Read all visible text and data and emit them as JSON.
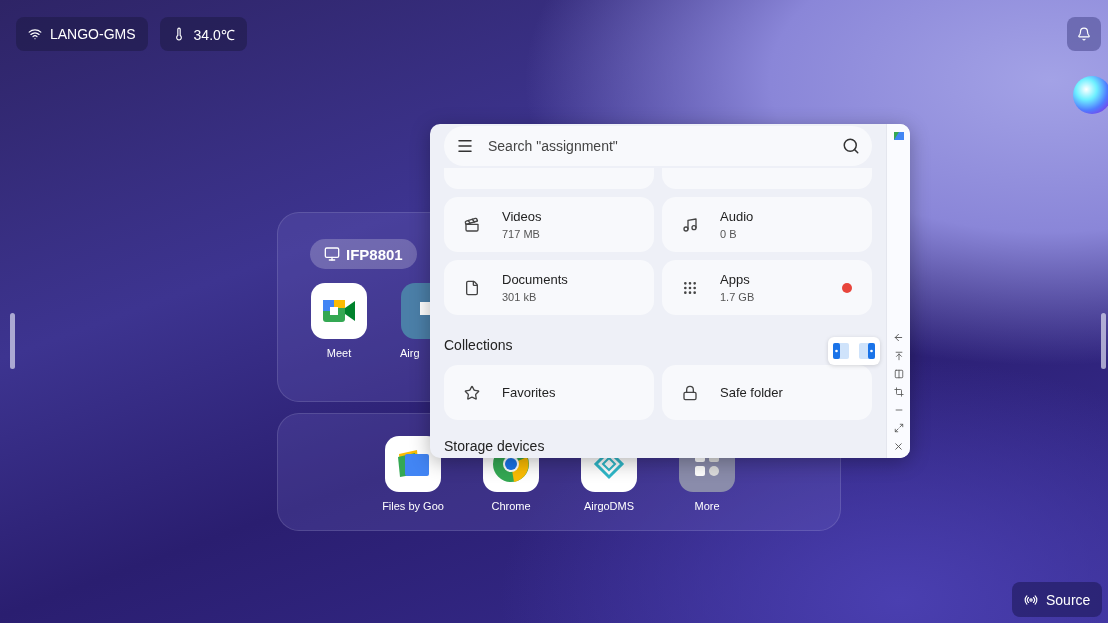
{
  "status_chips": [
    {
      "kind": "wifi",
      "label": "LANGO-GMS"
    },
    {
      "kind": "temperature",
      "label": "34.0℃"
    }
  ],
  "launcher": {
    "device": "IFP8801",
    "apps": [
      {
        "kind": "meet",
        "label": "Meet"
      },
      {
        "kind": "airgo",
        "label": "Airg"
      }
    ],
    "dock": [
      {
        "kind": "files",
        "label": "Files by Goo"
      },
      {
        "kind": "chrome",
        "label": "Chrome"
      },
      {
        "kind": "airgodms",
        "label": "AirgoDMS"
      },
      {
        "kind": "more",
        "label": "More"
      }
    ]
  },
  "files_window": {
    "search": {
      "placeholder": "Search \"assignment\""
    },
    "categories": [
      {
        "kind": "videos",
        "name": "Videos",
        "size": "717 MB",
        "badge": false
      },
      {
        "kind": "audio",
        "name": "Audio",
        "size": "0 B",
        "badge": false
      },
      {
        "kind": "documents",
        "name": "Documents",
        "size": "301 kB",
        "badge": false
      },
      {
        "kind": "apps",
        "name": "Apps",
        "size": "1.7 GB",
        "badge": true
      }
    ],
    "collections": {
      "title": "Collections",
      "items": [
        {
          "kind": "star",
          "name": "Favorites"
        },
        {
          "kind": "lock",
          "name": "Safe folder"
        }
      ]
    },
    "next_section": "Storage devices"
  },
  "source_button": "Source"
}
